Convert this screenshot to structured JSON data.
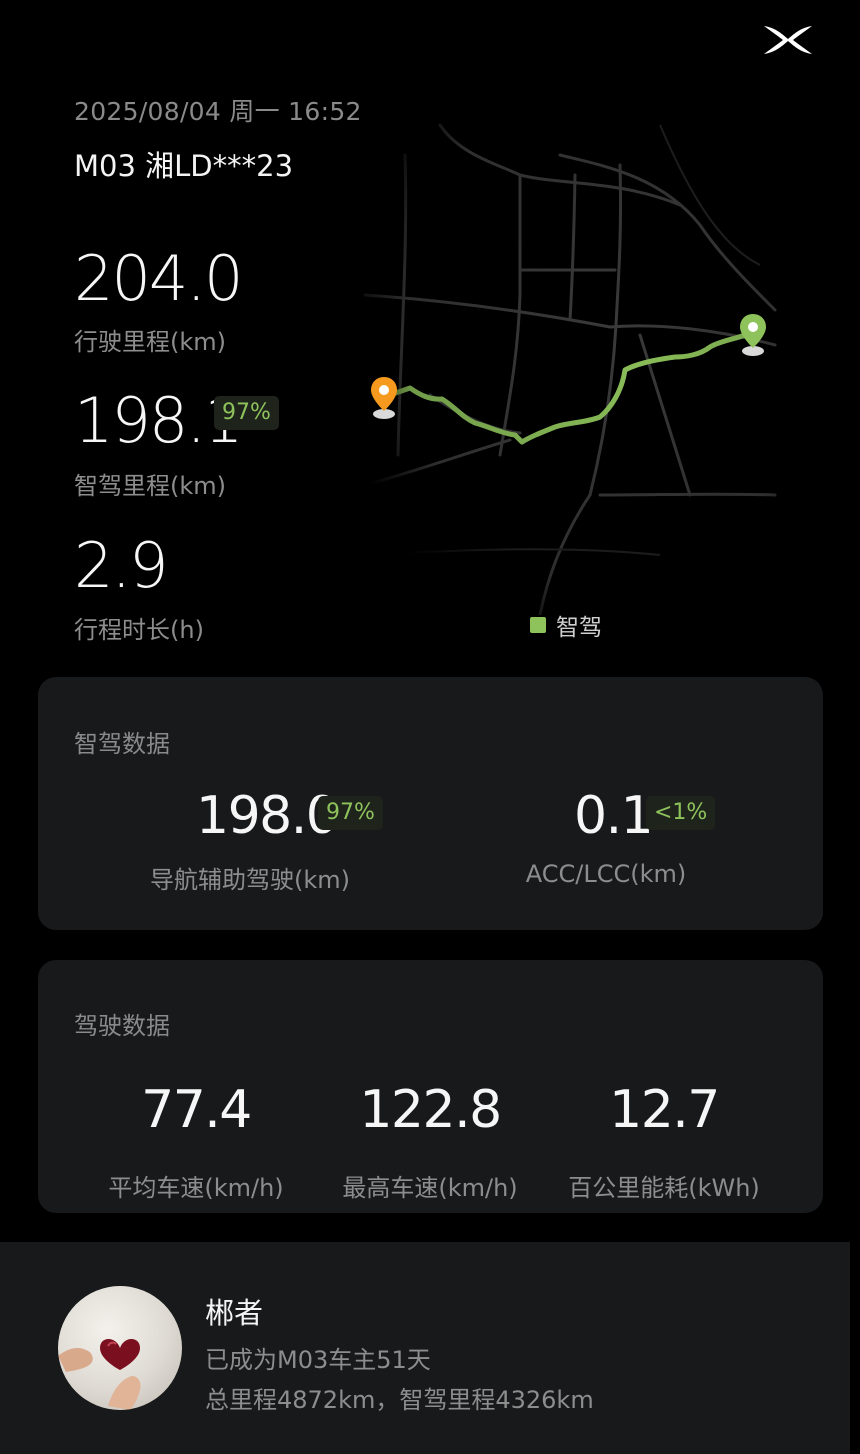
{
  "header": {
    "logo_icon": "brand-x-logo",
    "datetime": "2025/08/04 周一 16:52",
    "vehicle": "M03 湘LD***23"
  },
  "trip": {
    "distance_value": "204.0",
    "distance_label": "行驶里程(km)",
    "smart_value": "198.1",
    "smart_percent": "97%",
    "smart_label": "智驾里程(km)",
    "duration_value": "2.9",
    "duration_label": "行程时长(h)"
  },
  "map": {
    "legend_label": "智驾",
    "route_color": "#8ec35b",
    "start_marker_color": "#f59a1e",
    "end_marker_color": "#8ec35b",
    "start_icon": "start-pin-icon",
    "end_icon": "end-pin-icon"
  },
  "smart_driving": {
    "title": "智驾数据",
    "nav_value": "198.0",
    "nav_percent": "97%",
    "nav_label": "导航辅助驾驶(km)",
    "acc_value": "0.1",
    "acc_percent": "<1%",
    "acc_label": "ACC/LCC(km)"
  },
  "driving": {
    "title": "驾驶数据",
    "avg_speed_value": "77.4",
    "avg_speed_label": "平均车速(km/h)",
    "max_speed_value": "122.8",
    "max_speed_label": "最高车速(km/h)",
    "energy_value": "12.7",
    "energy_label": "百公里能耗(kWh)"
  },
  "profile": {
    "name": "郴者",
    "owner_line": "已成为M03车主51天",
    "mileage_line": "总里程4872km，智驾里程4326km"
  },
  "colors": {
    "accent": "#8ec35b",
    "background": "#000000",
    "card": "#17191b"
  }
}
